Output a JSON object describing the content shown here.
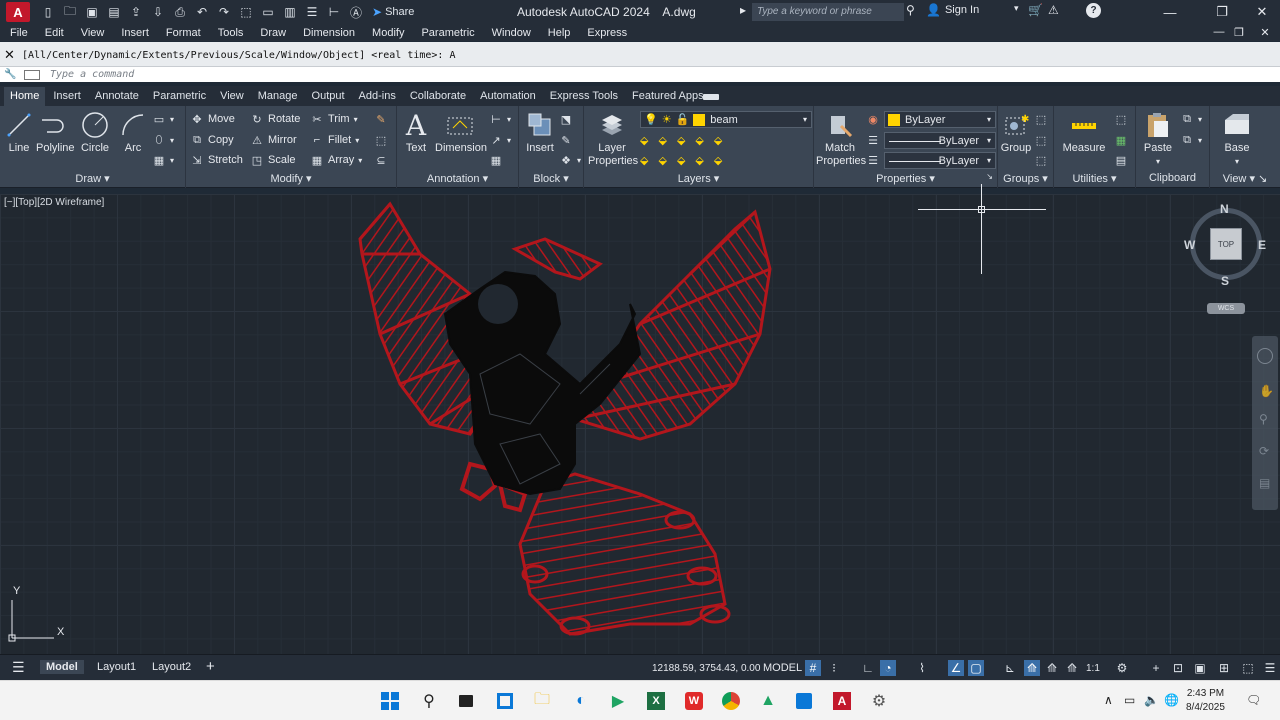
{
  "titlebar": {
    "logo": "A",
    "share_label": "Share",
    "title": "Autodesk AutoCAD 2024    A.dwg",
    "search_placeholder": "Type a keyword or phrase",
    "signin_label": "Sign In"
  },
  "menu": [
    "File",
    "Edit",
    "View",
    "Insert",
    "Format",
    "Tools",
    "Draw",
    "Dimension",
    "Modify",
    "Parametric",
    "Window",
    "Help",
    "Express"
  ],
  "command": {
    "history": "[All/Center/Dynamic/Extents/Previous/Scale/Window/Object] <real time>: A",
    "placeholder": "Type a command"
  },
  "ribbon_tabs": [
    {
      "label": "Home",
      "active": true
    },
    {
      "label": "Insert"
    },
    {
      "label": "Annotate"
    },
    {
      "label": "Parametric"
    },
    {
      "label": "View"
    },
    {
      "label": "Manage"
    },
    {
      "label": "Output"
    },
    {
      "label": "Add-ins"
    },
    {
      "label": "Collaborate"
    },
    {
      "label": "Automation"
    },
    {
      "label": "Express Tools"
    },
    {
      "label": "Featured Apps"
    }
  ],
  "panels": {
    "draw": {
      "title": "Draw",
      "line": "Line",
      "polyline": "Polyline",
      "circle": "Circle",
      "arc": "Arc"
    },
    "modify": {
      "title": "Modify",
      "move": "Move",
      "rotate": "Rotate",
      "trim": "Trim",
      "copy": "Copy",
      "mirror": "Mirror",
      "fillet": "Fillet",
      "stretch": "Stretch",
      "scale": "Scale",
      "array": "Array"
    },
    "annotation": {
      "title": "Annotation",
      "text": "Text",
      "dimension": "Dimension"
    },
    "block": {
      "title": "Block",
      "insert": "Insert"
    },
    "layers": {
      "title": "Layers",
      "layer_properties_1": "Layer",
      "layer_properties_2": "Properties",
      "current_layer": "beam"
    },
    "properties": {
      "title": "Properties",
      "match_1": "Match",
      "match_2": "Properties",
      "color": "ByLayer",
      "linetype": "ByLayer",
      "lineweight": "ByLayer"
    },
    "groups": {
      "title": "Groups",
      "group": "Group"
    },
    "utilities": {
      "title": "Utilities",
      "measure": "Measure"
    },
    "clipboard": {
      "title": "Clipboard",
      "paste": "Paste"
    },
    "view": {
      "title": "View",
      "base": "Base"
    }
  },
  "viewport": {
    "label": "[−][Top][2D Wireframe]",
    "viewcube": {
      "n": "N",
      "s": "S",
      "e": "E",
      "w": "W",
      "face": "TOP",
      "wcs": "WCS"
    },
    "ucs": {
      "x": "X",
      "y": "Y"
    }
  },
  "status": {
    "layouts": [
      {
        "label": "Model",
        "active": true
      },
      {
        "label": "Layout1"
      },
      {
        "label": "Layout2"
      }
    ],
    "coords": "12188.59, 3754.43, 0.00",
    "model": "MODEL",
    "scale": "1:1"
  },
  "taskbar": {
    "time": "2:43 PM",
    "date": "8/4/2025"
  },
  "colors": {
    "accent": "#c2182b",
    "wing_red": "#b3161c",
    "body_black": "#0b0b0b",
    "layer_yellow": "#ffd400"
  }
}
